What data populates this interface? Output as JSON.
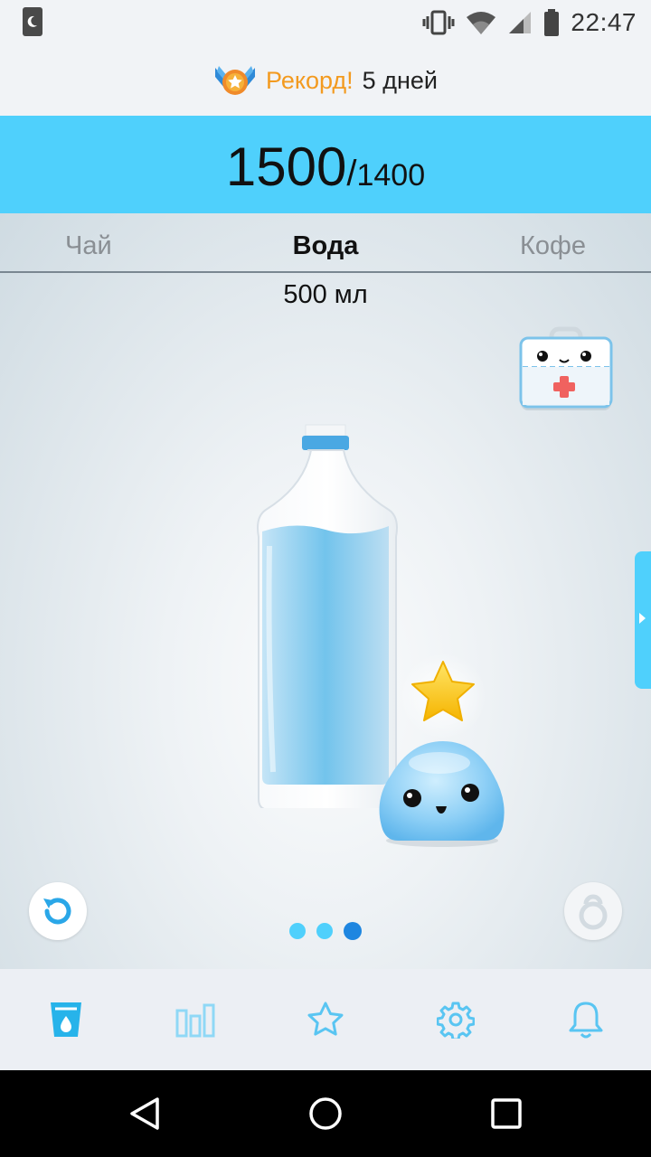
{
  "status_bar": {
    "time": "22:47"
  },
  "record": {
    "label": "Рекорд!",
    "value": "5 дней"
  },
  "counter": {
    "current": "1500",
    "separator": "/",
    "goal": "1400"
  },
  "drink_tabs": {
    "left": "Чай",
    "center": "Вода",
    "right": "Кофе"
  },
  "volume": "500 мл",
  "bottle_fill_fraction": 0.87,
  "pager": {
    "count": 3,
    "active_index": 2
  },
  "bottom_nav": {
    "items": [
      {
        "icon": "cup-icon",
        "active": true
      },
      {
        "icon": "bar-chart-icon",
        "active": false
      },
      {
        "icon": "star-icon",
        "active": false
      },
      {
        "icon": "gear-icon",
        "active": false
      },
      {
        "icon": "bell-icon",
        "active": false
      }
    ]
  },
  "colors": {
    "accent": "#4fd0fc",
    "record": "#f39a1f",
    "active_dot": "#1e86e0",
    "nav_icon": "#27b3ea"
  }
}
